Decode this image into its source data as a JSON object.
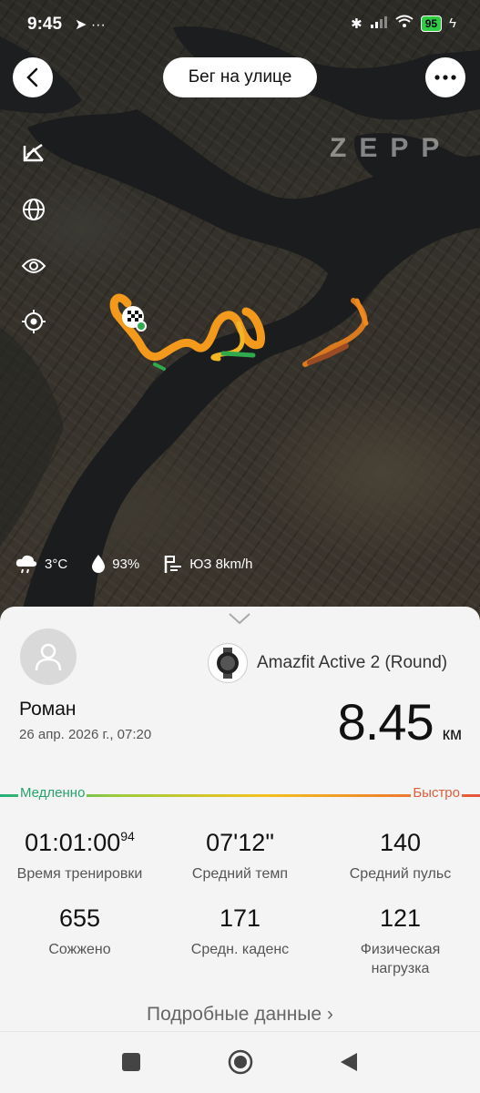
{
  "status_bar": {
    "time": "9:45",
    "extra_icons": "➤ ···",
    "battery": "95"
  },
  "header": {
    "title": "Бег на улице",
    "watermark": "ZEPP"
  },
  "map_tools": [
    "ruler-icon",
    "globe-icon",
    "eye-icon",
    "locate-icon"
  ],
  "weather": {
    "temperature": "3°C",
    "humidity": "93%",
    "wind": "ЮЗ 8km/h"
  },
  "workout": {
    "device": "Amazfit Active 2 (Round)",
    "user_name": "Роман",
    "date": "26 апр. 2026 г., 07:20",
    "distance": "8.45",
    "distance_unit": "км",
    "pace_scale": {
      "slow": "Медленно",
      "fast": "Быстро"
    },
    "stats": [
      {
        "value": "01:01:00",
        "suffix": "94",
        "label": "Время тренировки"
      },
      {
        "value": "07'12\"",
        "suffix": "",
        "label": "Средний темп"
      },
      {
        "value": "140",
        "suffix": "",
        "label": "Средний пульс"
      },
      {
        "value": "655",
        "suffix": "",
        "label": "Сожжено"
      },
      {
        "value": "171",
        "suffix": "",
        "label": "Средн. каденс"
      },
      {
        "value": "121",
        "suffix": "",
        "label": "Физическая нагрузка"
      }
    ],
    "details_link": "Подробные данные ›"
  },
  "colors": {
    "slow": "#27a36f",
    "fast": "#e05d3c",
    "route": "#f39a1c"
  }
}
